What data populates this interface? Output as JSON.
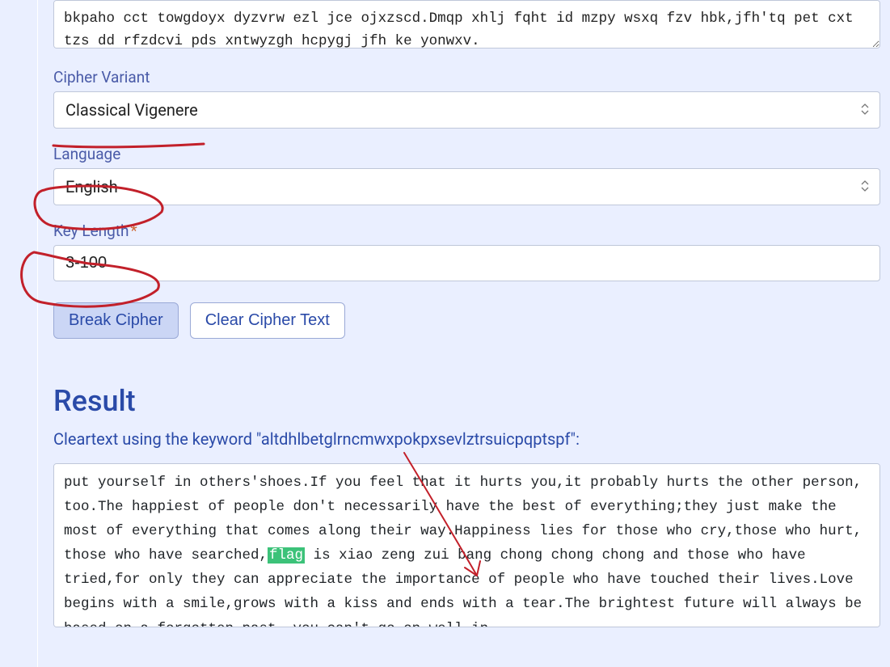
{
  "cipher_text_snippet": "bkpaho cct towgdoyx dyzvrw ezl jce ojxzscd.Dmqp xhlj fqht id mzpy wsxq fzv hbk,jfh'tq pet cxt tzs dd rfzdcvi pds xntwyzgh hcpygj jfh ke yonwxv.",
  "fields": {
    "cipher_variant_label": "Cipher Variant",
    "cipher_variant_value": "Classical Vigenere",
    "language_label": "Language",
    "language_value": "English",
    "key_length_label": "Key Length",
    "key_length_value": "3-100"
  },
  "buttons": {
    "break": "Break Cipher",
    "clear": "Clear Cipher Text"
  },
  "result": {
    "heading": "Result",
    "cleartext_label_prefix": "Cleartext using the keyword \"",
    "keyword": "altdhlbetglrncmwxpokpxsevlztrsuicpqptspf",
    "cleartext_label_suffix": "\":",
    "text_before_flag": "put yourself in others'shoes.If you feel that it hurts you,it probably hurts the other person, too.The happiest of people don't necessarily have the best of everything;they just make the most of everything that comes along their way.Happiness lies for those who cry,those who hurt, those who have searched,",
    "flag_word": "flag",
    "text_after_flag": " is xiao zeng zui bang chong chong chong and those who have tried,for only they can appreciate the importance of people who have touched their lives.Love begins with a smile,grows with a kiss and ends with a tear.The brightest future will always be based on a forgotten past, you can't go on well in"
  },
  "annotations": {
    "underline_color": "#c2202a",
    "arrow_color": "#c2202a",
    "circle_color": "#c2202a"
  }
}
